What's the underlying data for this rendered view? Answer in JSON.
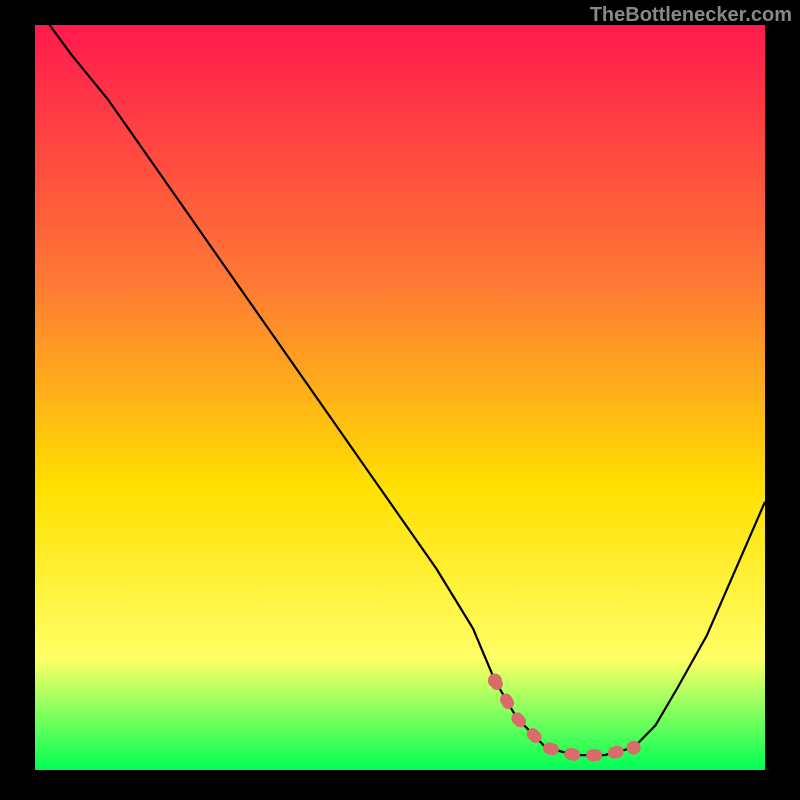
{
  "watermark": "TheBottlenecker.com",
  "chart_data": {
    "type": "line",
    "title": "",
    "xlabel": "",
    "ylabel": "",
    "xlim": [
      0,
      100
    ],
    "ylim": [
      0,
      100
    ],
    "grid": false,
    "background_gradient": {
      "top": "#ff1a4d",
      "mid_upper": "#ff7a33",
      "mid": "#ffe000",
      "lower": "#ffff66",
      "bottom": "#00ff55"
    },
    "series": [
      {
        "name": "curve",
        "color": "#000000",
        "x": [
          2,
          5,
          10,
          15,
          20,
          25,
          30,
          35,
          40,
          45,
          50,
          55,
          60,
          63,
          66,
          70,
          74,
          78,
          82,
          85,
          88,
          92,
          96,
          100
        ],
        "y": [
          100,
          96,
          90,
          83,
          76,
          69,
          62,
          55,
          48,
          41,
          34,
          27,
          19,
          12,
          7,
          3,
          2,
          2,
          3,
          6,
          11,
          18,
          27,
          36
        ]
      },
      {
        "name": "highlight",
        "color": "#d96b6b",
        "style": "thick-dotted",
        "x": [
          63,
          66,
          70,
          74,
          78,
          82
        ],
        "y": [
          12,
          7,
          3,
          2,
          2,
          3
        ]
      }
    ]
  }
}
